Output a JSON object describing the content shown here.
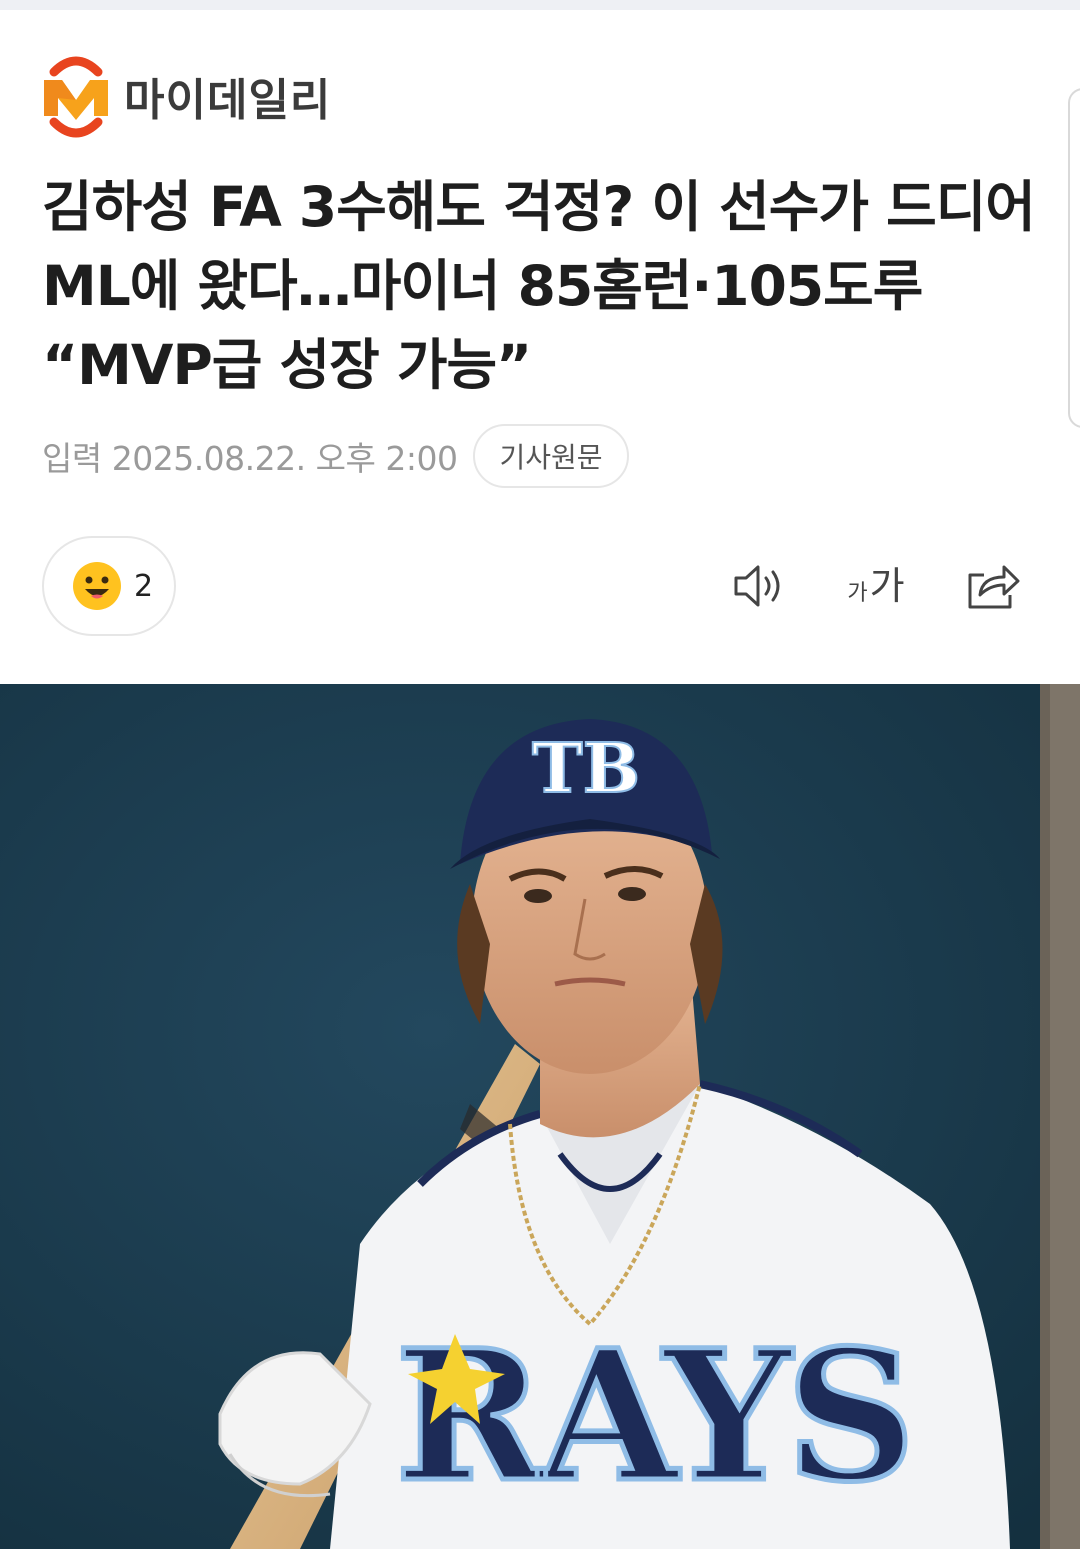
{
  "brand": {
    "name": "마이데일리",
    "logo_letter": "M"
  },
  "article": {
    "headline": "김하성 FA 3수해도 걱정? 이 선수가 드디어 ML에 왔다…마이너 85홈런·105도루 “MVP급 성장 가능”",
    "published": "입력 2025.08.22. 오후 2:00",
    "source_button": "기사원문"
  },
  "reaction": {
    "icon": "smile-emoji-icon",
    "count": "2"
  },
  "toolbar": {
    "tts_icon": "speaker-icon",
    "font_size_small": "가",
    "font_size_large": "가",
    "share_icon": "share-icon"
  },
  "photo": {
    "cap_logo": "TB",
    "jersey_text": "RAYS",
    "colors": {
      "background": "#1c3a4d",
      "navy": "#1d2b57",
      "light_blue": "#8fbce6",
      "gold": "#f5d130"
    }
  }
}
